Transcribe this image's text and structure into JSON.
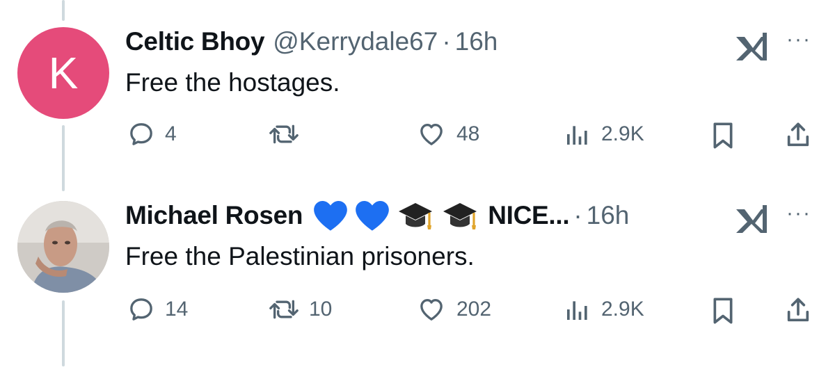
{
  "tweets": [
    {
      "author": "Celtic Bhoy",
      "handle": "@Kerrydale67",
      "separator": "·",
      "time": "16h",
      "avatar_letter": "K",
      "text": "Free the hostages.",
      "replies": "4",
      "retweets": "",
      "likes": "48",
      "views": "2.9K"
    },
    {
      "author": "Michael Rosen",
      "name_suffix": "NICE...",
      "emojis": [
        "blue-heart",
        "blue-heart",
        "graduation-cap",
        "graduation-cap"
      ],
      "separator": "·",
      "time": "16h",
      "text": "Free the Palestinian prisoners.",
      "replies": "14",
      "retweets": "10",
      "likes": "202",
      "views": "2.9K"
    }
  ],
  "more_label": "···",
  "colors": {
    "muted": "#536471",
    "text": "#0f1419",
    "avatar_k": "#e54b7a",
    "heart_blue": "#1d6ff2",
    "thread_line": "#cfd9de"
  }
}
